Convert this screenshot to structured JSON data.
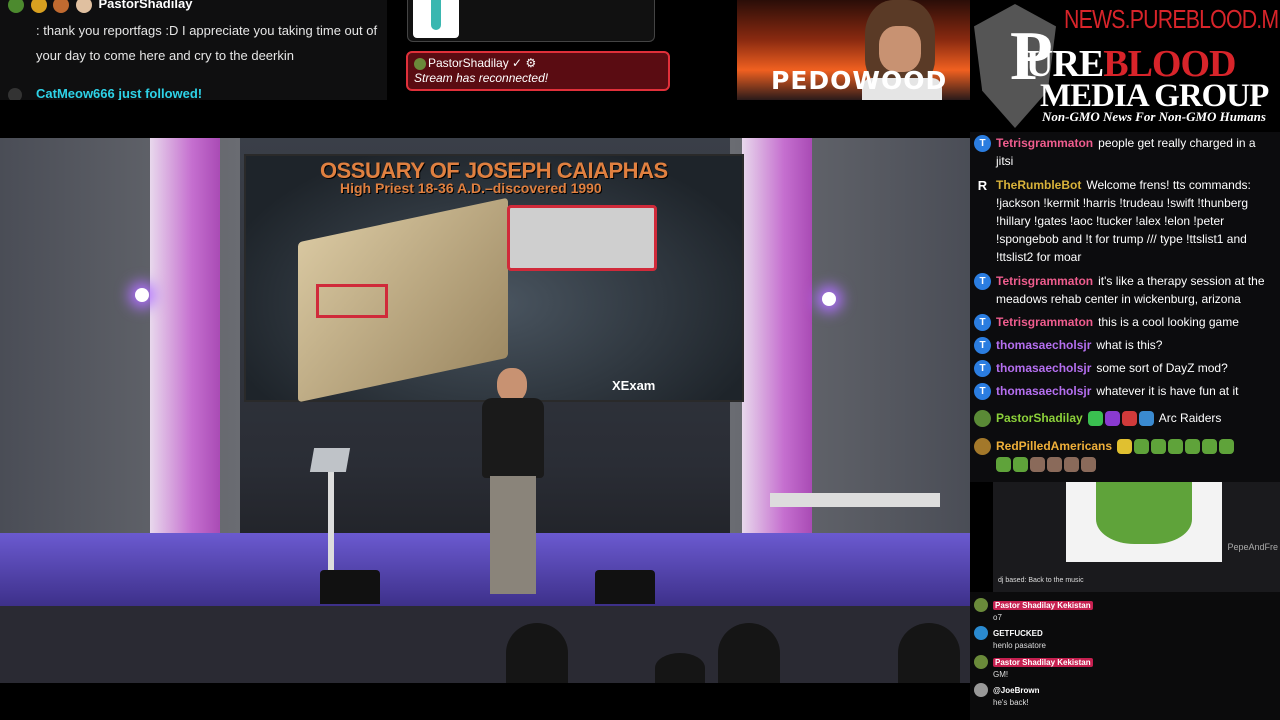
{
  "top_chat": {
    "username": "PastorShadilay",
    "message": ": thank you reportfags :D I appreciate you taking time out of your day to come here and cry to the deerkin",
    "follow": "CatMeow666 just followed!"
  },
  "alert": {
    "user": "PastorShadilay",
    "text": "Stream has reconnected!"
  },
  "banner": {
    "word": "PEDOWOOD"
  },
  "logo": {
    "url": "NEWS.PUREBLOOD.MEDIA",
    "line1_a": "URE",
    "line1_b": "BLOOD",
    "line2": "MEDIA GROUP",
    "tagline": "Non-GMO News For Non-GMO Humans"
  },
  "video": {
    "slide_title": "OSSUARY OF JOSEPH CAIAPHAS",
    "slide_subtitle": "High Priest 18-36 A.D.–discovered 1990",
    "credit": "XExam"
  },
  "chat": {
    "messages": [
      {
        "user": "Tetrisgrammaton",
        "text": "people get really charged in a jitsi",
        "avatar": "T",
        "color": "pink"
      },
      {
        "user": "TheRumbleBot",
        "text": "Welcome frens! tts commands: !jackson !kermit !harris !trudeau !swift !thunberg !hillary !gates !aoc !tucker !alex !elon !peter !spongebob and !t for trump /// type !ttslist1 and !ttslist2 for moar",
        "avatar": "R",
        "color": "gold"
      },
      {
        "user": "Tetrisgrammaton",
        "text": "it's like a therapy session at the meadows rehab center in wickenburg, arizona",
        "avatar": "T",
        "color": "pink"
      },
      {
        "user": "Tetrisgrammaton",
        "text": "this is a cool looking game",
        "avatar": "T",
        "color": "pink"
      },
      {
        "user": "thomasaecholsjr",
        "text": "what is this?",
        "avatar": "T",
        "color": "purple"
      },
      {
        "user": "thomasaecholsjr",
        "text": "some sort of DayZ mod?",
        "avatar": "T",
        "color": "purple"
      },
      {
        "user": "thomasaecholsjr",
        "text": "whatever it is have fun at it",
        "avatar": "T",
        "color": "purple"
      },
      {
        "user": "PastorShadilay",
        "text": "Arc Raiders",
        "avatar": "",
        "color": "green"
      },
      {
        "user": "RedPilledAmericans",
        "text": "",
        "avatar": "",
        "color": "orange"
      }
    ]
  },
  "pip": {
    "tag": "PepeAndFre",
    "caption": "dj based: Back to the music"
  },
  "mini_chat": [
    {
      "user": "Pastor Shadilay Kekistan",
      "text": "o7",
      "highlight": true
    },
    {
      "user": "GETFUCKED",
      "text": "henlo pasatore",
      "highlight": false
    },
    {
      "user": "Pastor Shadilay Kekistan",
      "text": "GM!",
      "highlight": true
    },
    {
      "user": "@JoeBrown",
      "text": "he's back!",
      "highlight": false
    }
  ],
  "colors": {
    "accent_red": "#d8242a",
    "chat_pink": "#ef5d8e",
    "chat_purple": "#b56ff0",
    "follow_cyan": "#2ed3e8"
  }
}
